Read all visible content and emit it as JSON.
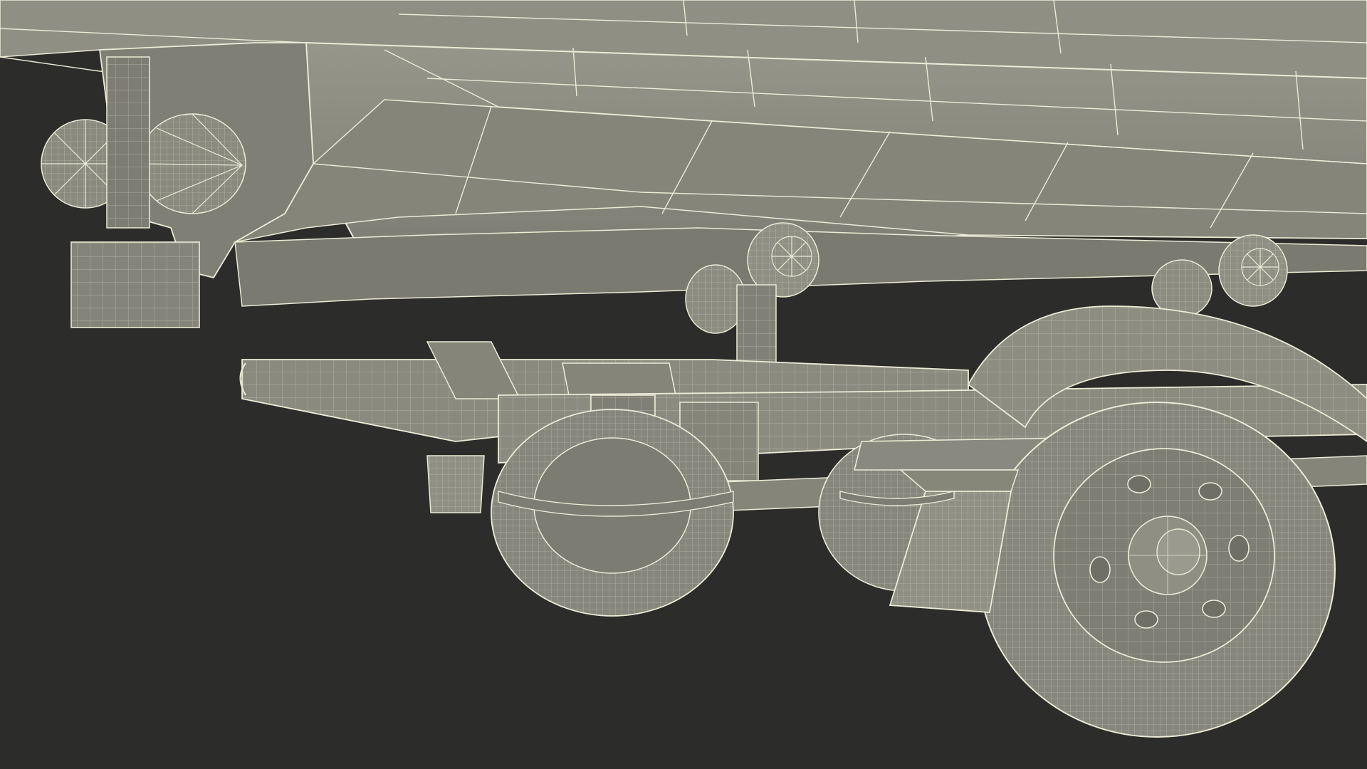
{
  "scene": {
    "subject": "boat-on-trailer-wireframe-render",
    "colors": {
      "background": "#2c2c2a",
      "surface": "#8b8b80",
      "surface_light": "#a3a397",
      "surface_dark": "#6a6a61",
      "wire": "#ecebd6",
      "tire": "#86867c"
    }
  }
}
